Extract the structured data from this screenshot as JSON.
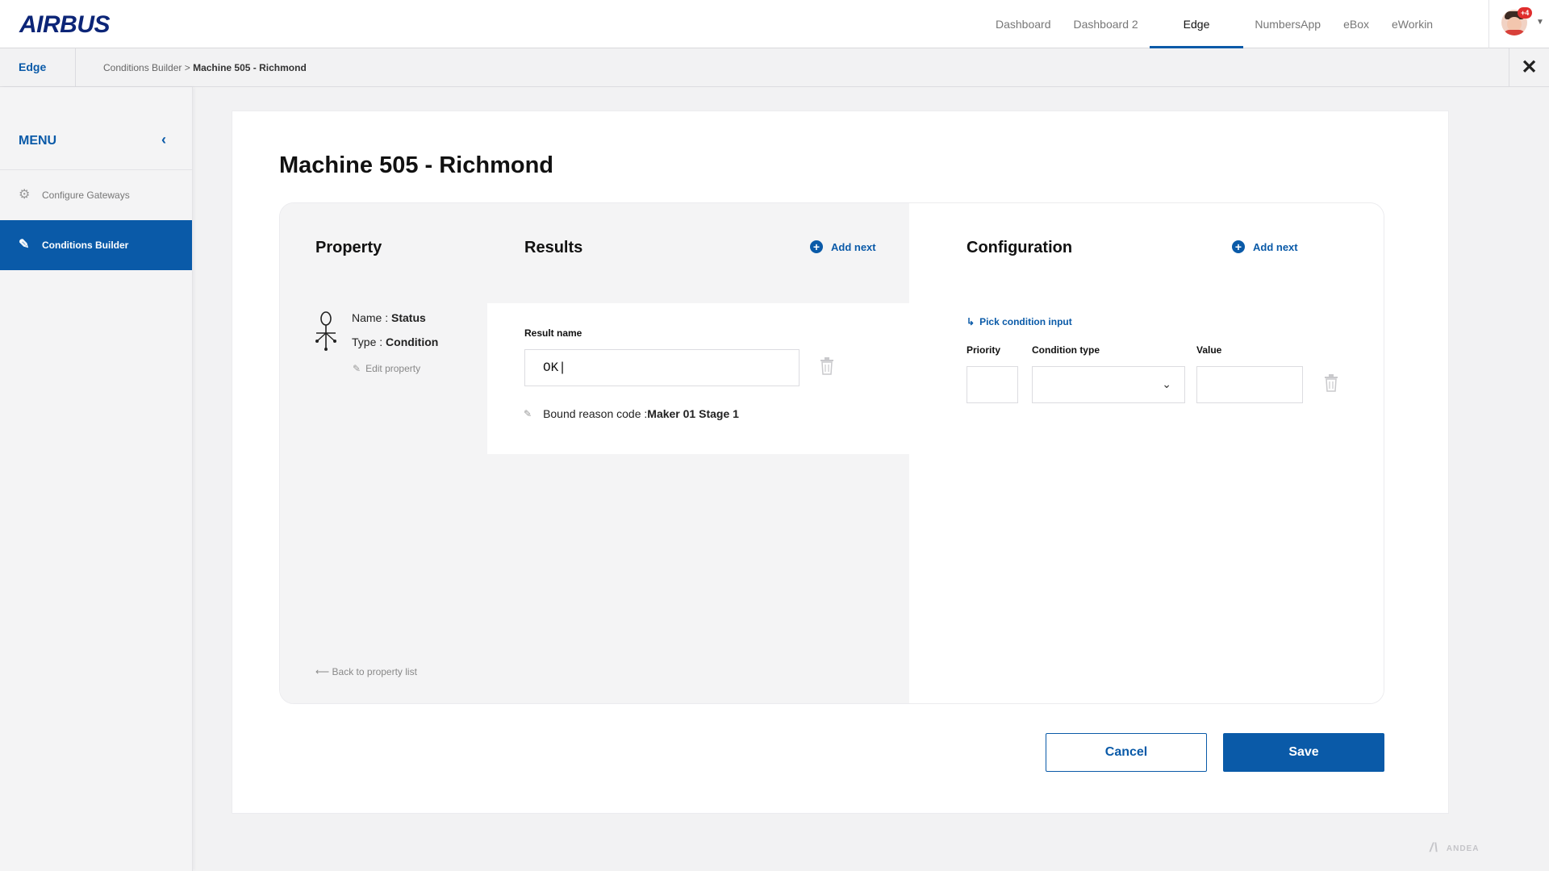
{
  "header": {
    "logo": "AIRBUS",
    "nav": [
      "Dashboard",
      "Dashboard 2",
      "Edge",
      "NumbersApp",
      "eBox",
      "eWorkin"
    ],
    "active_nav": "Edge",
    "notification_badge": "+4"
  },
  "subbar": {
    "app_name": "Edge",
    "breadcrumb_parent": "Conditions Builder",
    "breadcrumb_sep": " > ",
    "breadcrumb_current": "Machine 505 - Richmond"
  },
  "sidebar": {
    "title": "MENU",
    "items": [
      {
        "label": "Configure Gateways",
        "icon": "gear-icon",
        "active": false
      },
      {
        "label": "Conditions Builder",
        "icon": "edit-note-icon",
        "active": true
      }
    ]
  },
  "page": {
    "title": "Machine 505 - Richmond"
  },
  "property": {
    "heading": "Property",
    "name_label": "Name : ",
    "name_value": "Status",
    "type_label": "Type : ",
    "type_value": "Condition",
    "edit_label": "Edit property",
    "back_label": "Back to property list"
  },
  "results": {
    "heading": "Results",
    "add_next": "Add next",
    "result_name_label": "Result  name",
    "result_name_value": "OK|",
    "bound_label": "Bound reason code : ",
    "bound_value": "Maker 01 Stage 1"
  },
  "configuration": {
    "heading": "Configuration",
    "add_next": "Add next",
    "pick_label": "Pick condition input",
    "priority_label": "Priority",
    "condition_type_label": "Condition type",
    "value_label": "Value",
    "priority_value": "",
    "value_value": ""
  },
  "actions": {
    "cancel": "Cancel",
    "save": "Save"
  },
  "footer": {
    "brand": "ANDEA"
  },
  "colors": {
    "accent": "#0a5aa8",
    "logo": "#0c2577",
    "badge": "#e02d2d"
  }
}
